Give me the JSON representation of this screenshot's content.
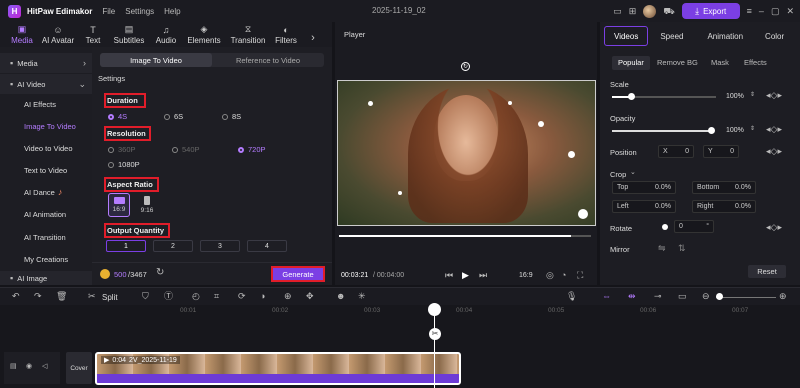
{
  "titlebar": {
    "app_name": "HitPaw Edimakor",
    "menus": [
      "File",
      "Settings",
      "Help"
    ],
    "doc_title": "2025-11-19_02",
    "export_label": "Export"
  },
  "toolbar": {
    "tools": [
      "Media",
      "AI Avatar",
      "Text",
      "Subtitles",
      "Audio",
      "Elements",
      "Transition",
      "Filters"
    ]
  },
  "sidebar": {
    "items": [
      {
        "label": "Media",
        "type": "top"
      },
      {
        "label": "AI Video",
        "type": "top"
      },
      {
        "label": "AI Effects"
      },
      {
        "label": "Image To Video",
        "selected": true
      },
      {
        "label": "Video to Video"
      },
      {
        "label": "Text to Video"
      },
      {
        "label": "AI Dance"
      },
      {
        "label": "AI Animation"
      },
      {
        "label": "AI Transition"
      },
      {
        "label": "My Creations"
      },
      {
        "label": "AI Image",
        "type": "top"
      }
    ]
  },
  "panel": {
    "tabs": [
      "Image To Video",
      "Reference to Video"
    ],
    "settings_label": "Settings",
    "duration_label": "Duration",
    "durations": [
      "4S",
      "6S",
      "8S"
    ],
    "resolution_label": "Resolution",
    "resolutions": [
      "360P",
      "540P",
      "720P",
      "1080P"
    ],
    "aspect_label": "Aspect Ratio",
    "aspects": [
      "16:9",
      "9:16"
    ],
    "quantity_label": "Output Quantity",
    "quantities": [
      "1",
      "2",
      "3",
      "4"
    ],
    "credits_used": "500",
    "credits_total": "/3467",
    "generate_label": "Generate"
  },
  "player": {
    "title": "Player",
    "time_current": "00:03:21",
    "time_total": "/ 00:04:00",
    "ratio": "16:9",
    "progress": 0.92
  },
  "right": {
    "tabs": [
      "Videos",
      "Speed",
      "Animation",
      "Color"
    ],
    "subtabs": [
      "Popular",
      "Remove BG",
      "Mask",
      "Effects"
    ],
    "scale_label": "Scale",
    "scale_value": "100%",
    "opacity_label": "Opacity",
    "opacity_value": "100%",
    "position_label": "Position",
    "pos_x_label": "X",
    "pos_x": "0",
    "pos_y_label": "Y",
    "pos_y": "0",
    "crop_label": "Crop",
    "crop_top_label": "Top",
    "crop_top": "0.0%",
    "crop_bottom_label": "Bottom",
    "crop_bottom": "0.0%",
    "crop_left_label": "Left",
    "crop_left": "0.0%",
    "crop_right_label": "Right",
    "crop_right": "0.0%",
    "rotate_label": "Rotate",
    "rotate_value": "0",
    "mirror_label": "Mirror",
    "reset_label": "Reset"
  },
  "timeline": {
    "split_label": "Split",
    "ruler": [
      "00:01",
      "00:02",
      "00:03",
      "00:04",
      "00:05",
      "00:06",
      "00:07"
    ],
    "cover_label": "Cover",
    "clip_time": "0:04",
    "clip_name": "2V_2025-11-19"
  },
  "colors": {
    "accent": "#7b3fe4",
    "highlight_box": "#e11d2a"
  }
}
